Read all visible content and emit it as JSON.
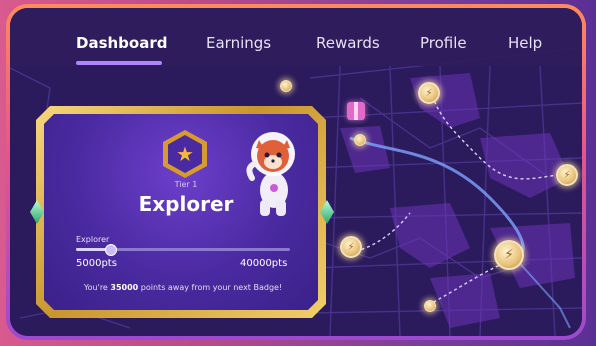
{
  "nav": {
    "items": [
      {
        "label": "Dashboard",
        "active": true
      },
      {
        "label": "Earnings",
        "active": false
      },
      {
        "label": "Rewards",
        "active": false
      },
      {
        "label": "Profile",
        "active": false
      },
      {
        "label": "Help",
        "active": false
      }
    ]
  },
  "badge_card": {
    "tier_label": "Tier 1",
    "tier_name": "Explorer",
    "progress": {
      "label": "Explorer",
      "min_label": "5000pts",
      "max_label": "40000pts",
      "fraction": 0.16
    },
    "footer": {
      "prefix": "You're ",
      "points": "35000",
      "suffix": " points away from your next Badge!"
    }
  },
  "colors": {
    "accent": "#b083ff",
    "gold": "#e8c27a",
    "card_bg": "#4a2aa0",
    "map_bg": "#2b1a5c"
  },
  "icons": {
    "tier_star": "star-icon",
    "map_pins": "coin-pin-icon",
    "gift": "gift-icon"
  }
}
